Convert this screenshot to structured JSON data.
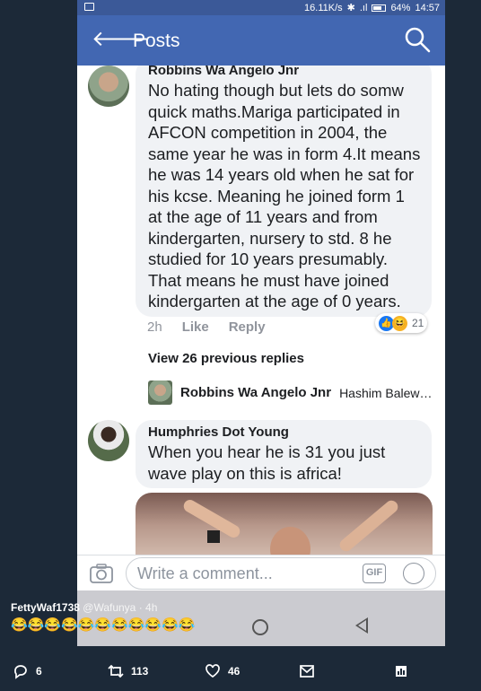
{
  "status_bar": {
    "speed": "16.11K/s",
    "battery": "64%",
    "time": "14:57"
  },
  "app_bar": {
    "title": "Posts"
  },
  "comment1": {
    "author": "Robbins Wa Angelo Jnr",
    "text": "No hating though but lets do somw quick maths.Mariga participated in AFCON competition in 2004, the same year he was in form 4.It means he was 14 years old when he sat for his kcse. Meaning he joined form 1 at the age of 11 years and from kindergarten, nursery to std. 8 he studied for 10 years presumably. That means he must have joined kindergarten at the age of 0 years.",
    "time": "2h",
    "like_label": "Like",
    "reply_label": "Reply",
    "reaction_count": "21"
  },
  "view_previous": "View 26 previous replies",
  "latest_reply": {
    "author": "Robbins Wa Angelo Jnr",
    "preview": "Hashim Balew…"
  },
  "comment2": {
    "author": "Humphries Dot Young",
    "text": "When you hear he is 31 you just wave play on this is africa!"
  },
  "composer": {
    "placeholder": "Write a comment...",
    "gif_label": "GIF"
  },
  "tweet": {
    "name": "FettyWaf1738",
    "handle": "@Wafunya",
    "age": "· 4h",
    "emoji": "😂😂😂😂😂😂😂😂😂😂😂"
  },
  "tweet_actions": {
    "replies": "6",
    "retweets": "113",
    "likes": "46"
  },
  "colors": {
    "facebook_blue": "#4267b2",
    "twitter_bg": "#1c2938"
  },
  "icons": [
    "back-arrow-icon",
    "search-icon",
    "camera-icon",
    "gif-icon",
    "smiley-icon",
    "reply-icon",
    "retweet-icon",
    "heart-icon",
    "mail-icon",
    "analytics-icon"
  ]
}
